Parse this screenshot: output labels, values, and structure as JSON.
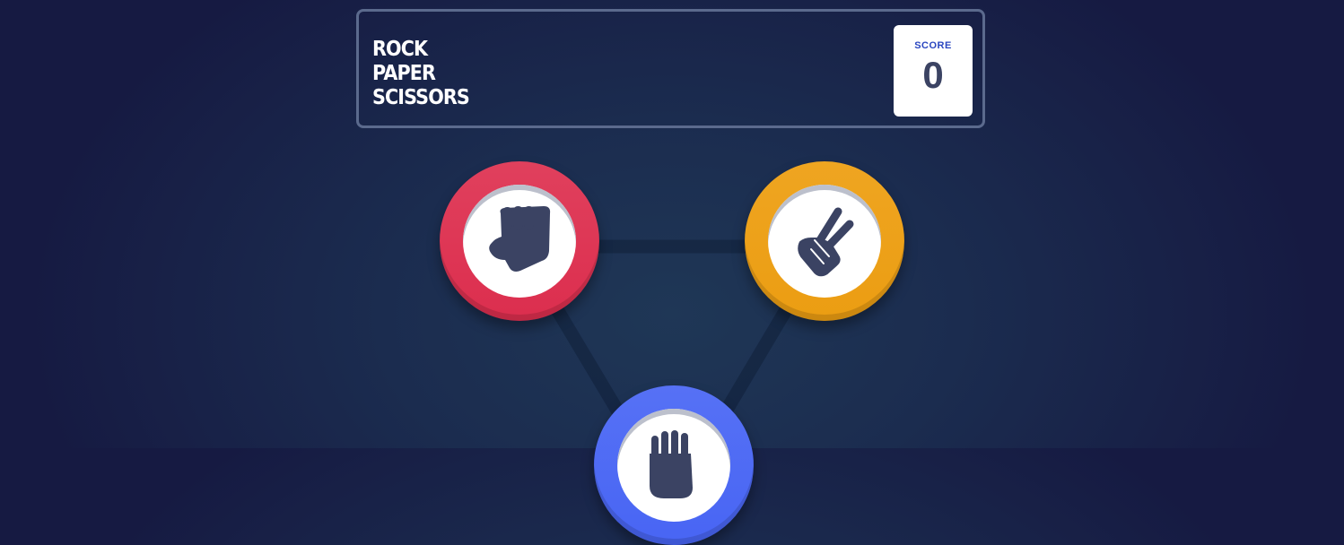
{
  "header": {
    "title_lines": [
      "ROCK",
      "PAPER",
      "SCISSORS"
    ],
    "score_label": "SCORE",
    "score_value": "0"
  },
  "choices": [
    {
      "id": "rock",
      "color": "#dc2e4e",
      "icon": "rock-fist-icon"
    },
    {
      "id": "scissors",
      "color": "#eb9d12",
      "icon": "scissors-hand-icon"
    },
    {
      "id": "paper",
      "color": "#4865f4",
      "icon": "paper-hand-icon"
    }
  ],
  "colors": {
    "icon": "#3b4363",
    "background": "#1f3756",
    "header_border": "#5b6a8d"
  }
}
